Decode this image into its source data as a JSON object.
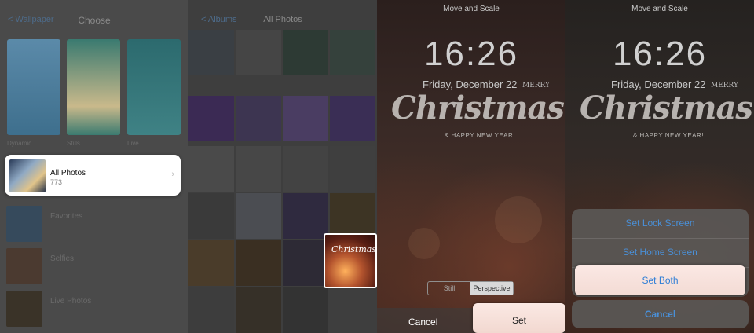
{
  "panel1": {
    "nav_back": "< Wallpaper",
    "nav_title": "Choose",
    "wallpapers": [
      {
        "caption": "Dynamic",
        "color": "#5a89a8"
      },
      {
        "caption": "Stills",
        "color": "#3f7c75"
      },
      {
        "caption": "Live",
        "color": "#2f6a6e"
      }
    ],
    "selected_album": {
      "title": "All Photos",
      "count": "773"
    },
    "other_albums": [
      {
        "title": "Favorites",
        "count": ""
      },
      {
        "title": "Selfies",
        "count": ""
      },
      {
        "title": "Live Photos",
        "count": ""
      }
    ]
  },
  "panel2": {
    "nav_back": "< Albums",
    "nav_title": "All Photos"
  },
  "panel3": {
    "header": "Move and Scale",
    "time": "16:26",
    "date": "Friday, December 22",
    "art_main": "Christmas",
    "art_merry": "MERRY",
    "art_sub": "& HAPPY NEW YEAR!",
    "segment": [
      "Still",
      "Perspective"
    ],
    "cancel": "Cancel",
    "set": "Set"
  },
  "panel4": {
    "header": "Move and Scale",
    "time": "16:26",
    "date": "Friday, December 22",
    "art_main": "Christmas",
    "art_merry": "MERRY",
    "art_sub": "& HAPPY NEW YEAR!",
    "options": [
      "Set Lock Screen",
      "Set Home Screen",
      "Set Both"
    ],
    "cancel": "Cancel"
  }
}
